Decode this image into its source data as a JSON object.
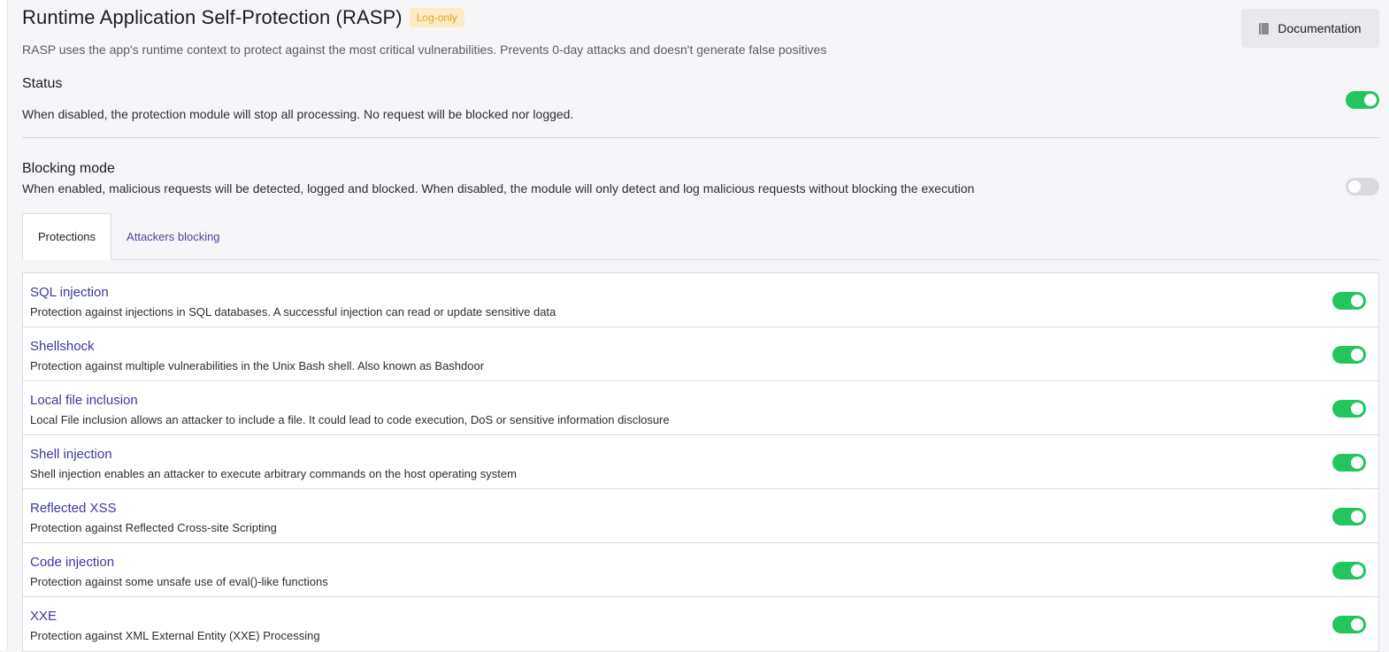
{
  "header": {
    "title": "Runtime Application Self-Protection (RASP)",
    "badge": "Log-only",
    "subtitle": "RASP uses the app's runtime context to protect against the most critical vulnerabilities. Prevents 0-day attacks and doesn't generate false positives",
    "documentation_label": "Documentation"
  },
  "status": {
    "title": "Status",
    "description": "When disabled, the protection module will stop all processing. No request will be blocked nor logged.",
    "enabled": true
  },
  "blocking": {
    "title": "Blocking mode",
    "description": "When enabled, malicious requests will be detected, logged and blocked. When disabled, the module will only detect and log malicious requests without blocking the execution",
    "enabled": false
  },
  "tabs": [
    {
      "label": "Protections",
      "active": true
    },
    {
      "label": "Attackers blocking",
      "active": false
    }
  ],
  "protections": [
    {
      "title": "SQL injection",
      "description": "Protection against injections in SQL databases. A successful injection can read or update sensitive data",
      "enabled": true
    },
    {
      "title": "Shellshock",
      "description": "Protection against multiple vulnerabilities in the Unix Bash shell. Also known as Bashdoor",
      "enabled": true
    },
    {
      "title": "Local file inclusion",
      "description": "Local File inclusion allows an attacker to include a file. It could lead to code execution, DoS or sensitive information disclosure",
      "enabled": true
    },
    {
      "title": "Shell injection",
      "description": "Shell injection enables an attacker to execute arbitrary commands on the host operating system",
      "enabled": true
    },
    {
      "title": "Reflected XSS",
      "description": "Protection against Reflected Cross-site Scripting",
      "enabled": true
    },
    {
      "title": "Code injection",
      "description": "Protection against some unsafe use of eval()-like functions",
      "enabled": true
    },
    {
      "title": "XXE",
      "description": "Protection against XML External Entity (XXE) Processing",
      "enabled": true
    }
  ],
  "colors": {
    "toggle_on": "#22c55e",
    "toggle_off": "#d9d9df",
    "link": "#3d38a3",
    "badge_bg": "#fdecc8",
    "badge_text": "#f0a21d"
  },
  "icons": {
    "documentation": "book-icon"
  }
}
